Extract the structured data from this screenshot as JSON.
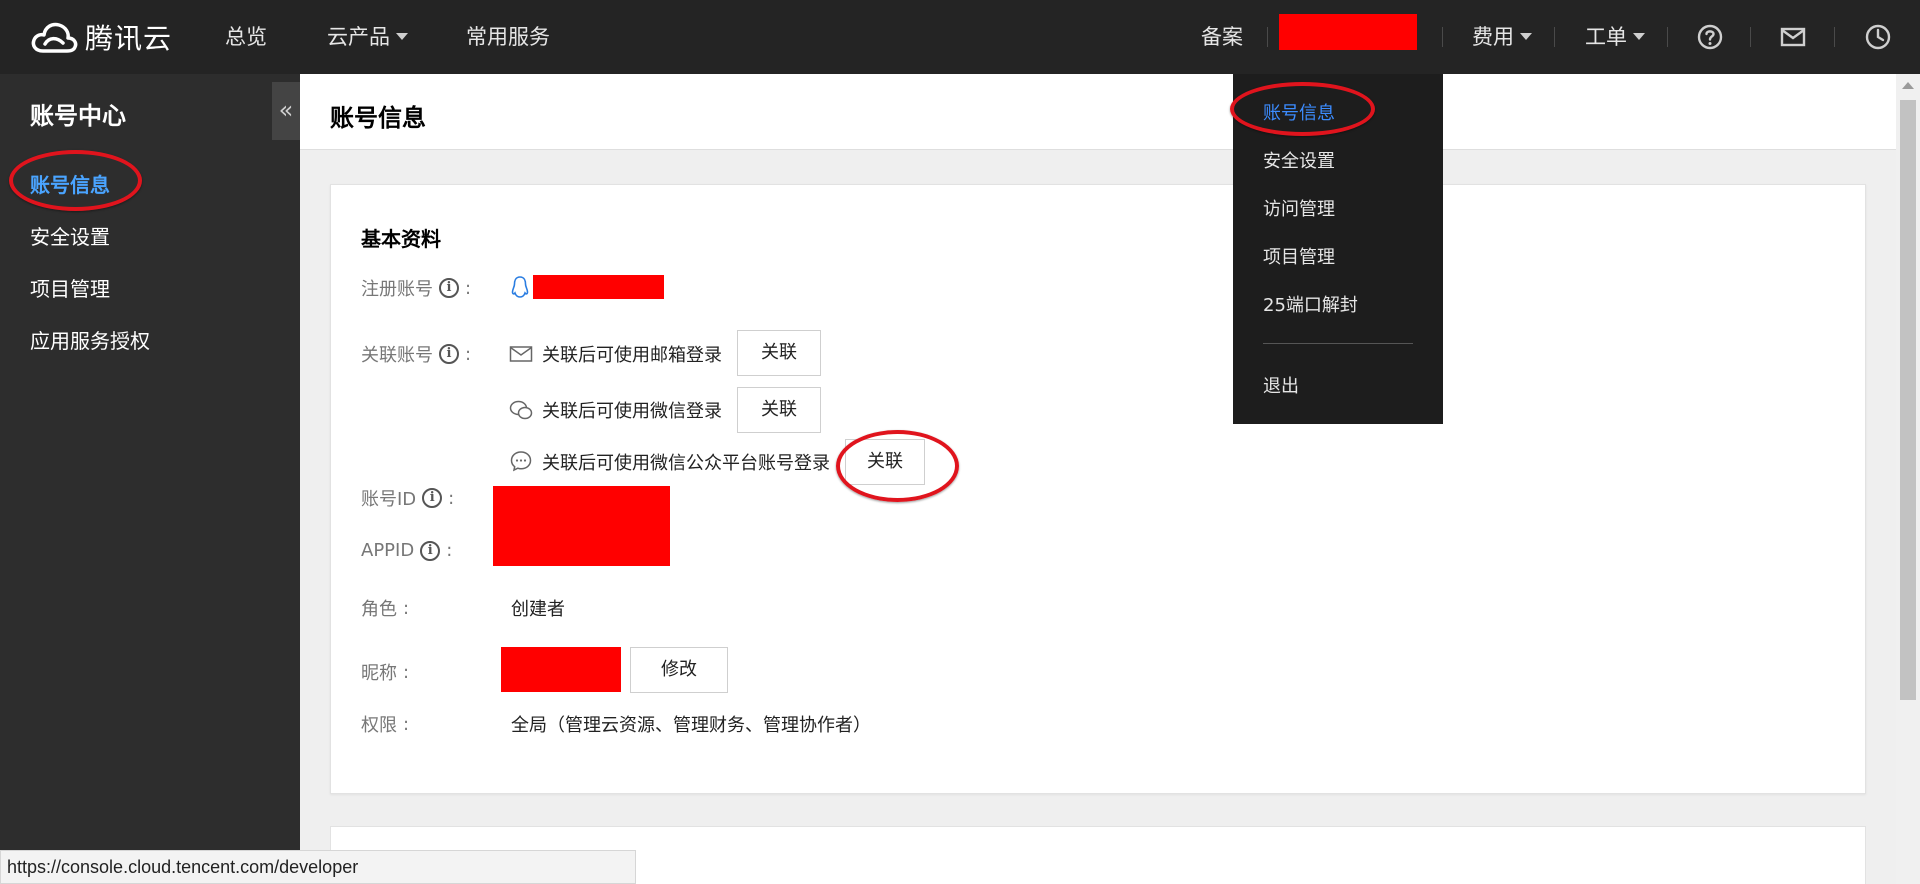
{
  "app": {
    "logo_text": "腾讯云"
  },
  "topnav": {
    "left": [
      "总览",
      "云产品",
      "常用服务"
    ],
    "record": "备案",
    "fees": "费用",
    "ticket": "工单",
    "icons": [
      "help-circle-icon",
      "mail-icon",
      "clock-icon"
    ]
  },
  "sidebar": {
    "title": "账号中心",
    "items": [
      "账号信息",
      "安全设置",
      "项目管理",
      "应用服务授权"
    ],
    "active_index": 0,
    "collapse_glyph": "«"
  },
  "main": {
    "title": "账号信息"
  },
  "profile": {
    "section_title": "基本资料",
    "registered_account_label": "注册账号",
    "linked_accounts_label": "关联账号",
    "linked_accounts": [
      {
        "icon": "mail-icon",
        "text": "关联后可使用邮箱登录",
        "button": "关联"
      },
      {
        "icon": "wechat-icon",
        "text": "关联后可使用微信登录",
        "button": "关联"
      },
      {
        "icon": "chat-bubble-icon",
        "text": "关联后可使用微信公众平台账号登录",
        "button": "关联"
      }
    ],
    "account_id_label": "账号ID",
    "appid_label": "APPID",
    "role_label": "角色",
    "role_value": "创建者",
    "nickname_label": "昵称",
    "nickname_edit_button": "修改",
    "permission_label": "权限",
    "permission_value": "全局（管理云资源、管理财务、管理协作者）",
    "colon": ":"
  },
  "dropdown": {
    "items": [
      "账号信息",
      "安全设置",
      "访问管理",
      "项目管理",
      "25端口解封"
    ],
    "active_index": 0,
    "logout": "退出"
  },
  "statusbar": {
    "url": "https://console.cloud.tencent.com/developer"
  },
  "colors": {
    "accent": "#4aa4ff",
    "topbar": "#242424",
    "sidebar": "#2d2d2d",
    "redaction": "#ff0000",
    "annotation": "#e0141d"
  }
}
